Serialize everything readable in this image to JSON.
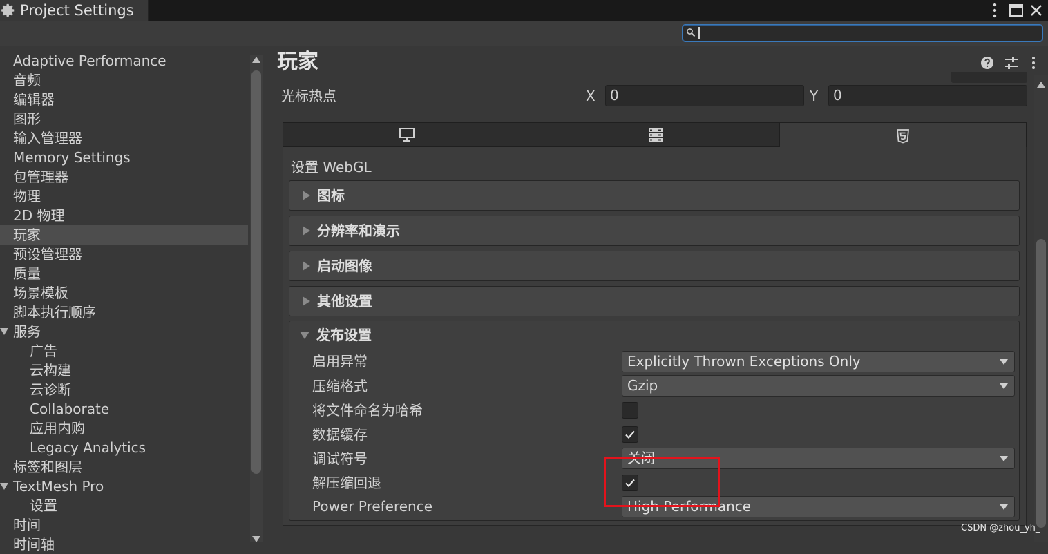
{
  "window": {
    "tab_title": "Project Settings"
  },
  "search": {
    "value": "",
    "placeholder": ""
  },
  "sidebar": {
    "items": [
      {
        "label": "Adaptive Performance"
      },
      {
        "label": "音频"
      },
      {
        "label": "编辑器"
      },
      {
        "label": "图形"
      },
      {
        "label": "输入管理器"
      },
      {
        "label": "Memory Settings"
      },
      {
        "label": "包管理器"
      },
      {
        "label": "物理"
      },
      {
        "label": "2D 物理"
      },
      {
        "label": "玩家",
        "selected": true
      },
      {
        "label": "预设管理器"
      },
      {
        "label": "质量"
      },
      {
        "label": "场景模板"
      },
      {
        "label": "脚本执行顺序"
      },
      {
        "label": "服务",
        "expanded": true
      },
      {
        "label": "广告"
      },
      {
        "label": "云构建"
      },
      {
        "label": "云诊断"
      },
      {
        "label": "Collaborate"
      },
      {
        "label": "应用内购"
      },
      {
        "label": "Legacy Analytics"
      },
      {
        "label": "标签和图层"
      },
      {
        "label": "TextMesh Pro",
        "expanded": true
      },
      {
        "label": "设置"
      },
      {
        "label": "时间"
      },
      {
        "label": "时间轴"
      }
    ]
  },
  "main": {
    "title": "玩家",
    "cursor_hotspot": {
      "label": "光标热点",
      "x_label": "X",
      "x_value": "0",
      "y_label": "Y",
      "y_value": "0"
    },
    "platform_tabs": [
      {
        "icon": "monitor-icon"
      },
      {
        "icon": "server-icon"
      },
      {
        "icon": "html5-icon",
        "active": true
      }
    ],
    "settings_for": "设置 WebGL",
    "sections": [
      {
        "title": "图标",
        "expanded": false
      },
      {
        "title": "分辨率和演示",
        "expanded": false
      },
      {
        "title": "启动图像",
        "expanded": false
      },
      {
        "title": "其他设置",
        "expanded": false
      },
      {
        "title": "发布设置",
        "expanded": true
      }
    ],
    "publishing": {
      "enable_exceptions": {
        "label": "启用异常",
        "value": "Explicitly Thrown Exceptions Only"
      },
      "compression_format": {
        "label": "压缩格式",
        "value": "Gzip"
      },
      "name_files_as_hashes": {
        "label": "将文件命名为哈希",
        "checked": false
      },
      "data_caching": {
        "label": "数据缓存",
        "checked": true
      },
      "debug_symbols": {
        "label": "调试符号",
        "value": "关闭"
      },
      "decompression_fallback": {
        "label": "解压缩回退",
        "checked": true
      },
      "power_preference": {
        "label": "Power Preference",
        "value": "High Performance"
      }
    }
  },
  "watermark": "CSDN @zhou_yh_",
  "colors": {
    "background": "#383838",
    "selected_item": "#4d4d4d",
    "search_focus": "#3a79bb",
    "highlight_box": "#e3131c"
  }
}
